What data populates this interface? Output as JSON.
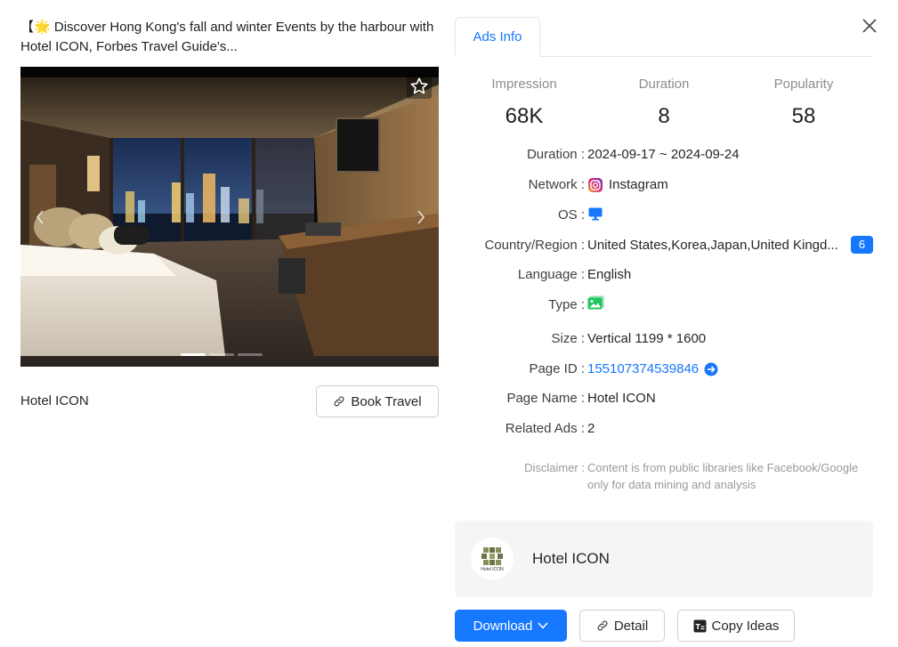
{
  "ad": {
    "title_prefix": "【",
    "title_emoji": "🌟",
    "title_text": "Discover Hong Kong's fall and winter Events by the harbour with Hotel ICON, Forbes Travel Guide's..."
  },
  "media": {
    "slide_count": 3,
    "active_slide": 1
  },
  "brand_name": "Hotel ICON",
  "book_button_label": "Book Travel",
  "tabs": [
    {
      "label": "Ads Info",
      "active": true
    }
  ],
  "stats": [
    {
      "label": "Impression",
      "value": "68K"
    },
    {
      "label": "Duration",
      "value": "8"
    },
    {
      "label": "Popularity",
      "value": "58"
    }
  ],
  "info": {
    "duration": {
      "label": "Duration :",
      "value": "2024-09-17 ~ 2024-09-24"
    },
    "network": {
      "label": "Network :",
      "value": "Instagram",
      "icon": "instagram-icon"
    },
    "os": {
      "label": "OS :",
      "icon": "desktop-icon"
    },
    "country": {
      "label": "Country/Region :",
      "value": "United States,Korea,Japan,United Kingd...",
      "count": "6"
    },
    "language": {
      "label": "Language :",
      "value": "English"
    },
    "type": {
      "label": "Type :",
      "icon": "image-type-icon"
    },
    "size": {
      "label": "Size :",
      "value": "Vertical 1199 * 1600"
    },
    "page_id": {
      "label": "Page ID :",
      "value": "155107374539846",
      "icon": "arrow-circle-right-icon"
    },
    "page_name": {
      "label": "Page Name :",
      "value": "Hotel ICON"
    },
    "related_ads": {
      "label": "Related Ads :",
      "value": "2"
    }
  },
  "disclaimer": {
    "label": "Disclaimer :",
    "text": "Content is from public libraries like Facebook/Google only for data mining and analysis"
  },
  "advertiser": {
    "name": "Hotel ICON",
    "logo_text": "Hotel ICON"
  },
  "actions": {
    "download": "Download",
    "detail": "Detail",
    "copy_ideas": "Copy Ideas"
  },
  "colors": {
    "accent": "#1677ff",
    "instagram": "#d62976",
    "type_icon": "#22c55e",
    "muted_text": "#8c8c8c"
  }
}
